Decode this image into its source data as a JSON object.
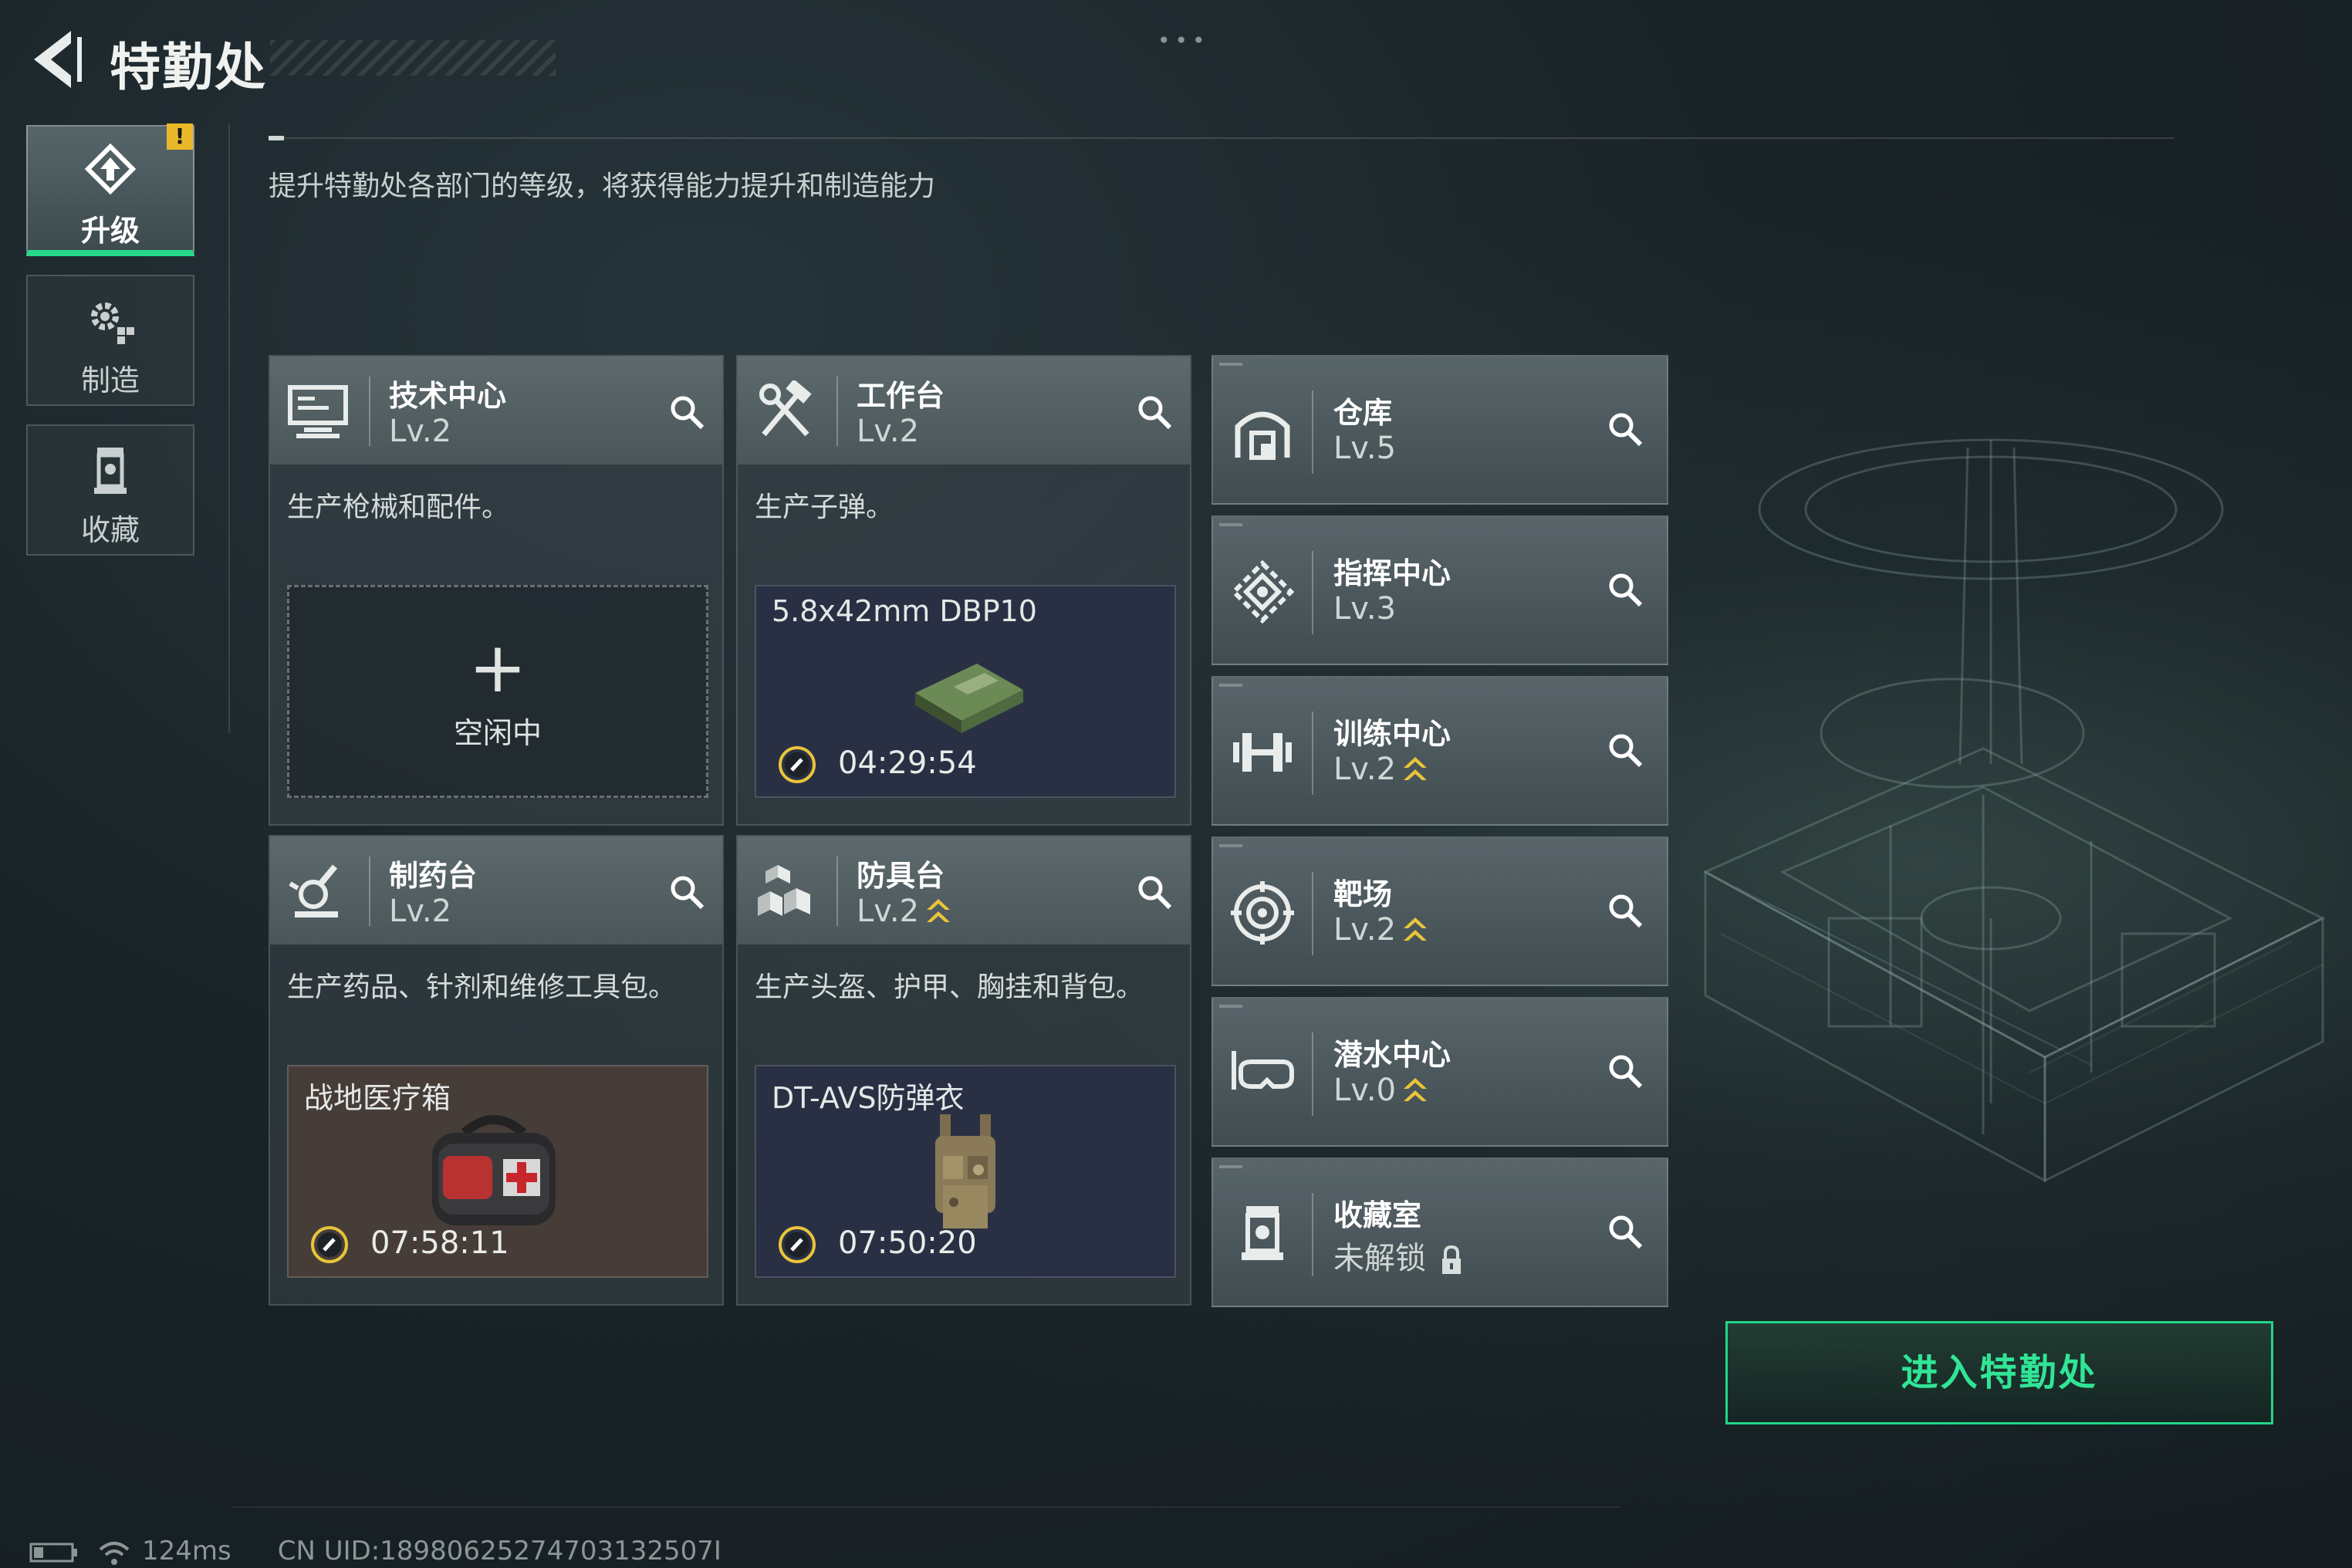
{
  "header": {
    "title": "特勤处"
  },
  "nav": {
    "tabs": [
      {
        "label": "升级",
        "icon": "upgrade-icon",
        "active": true,
        "badge": "!"
      },
      {
        "label": "制造",
        "icon": "gears-icon",
        "active": false
      },
      {
        "label": "收藏",
        "icon": "display-case-icon",
        "active": false
      }
    ]
  },
  "description": "提升特勤处各部门的等级，将获得能力提升和制造能力",
  "production": [
    {
      "name": "技术中心",
      "level": "Lv.2",
      "desc": "生产枪械和配件。",
      "icon": "computer-icon",
      "slot": {
        "state": "idle",
        "plus": "+",
        "status": "空闲中"
      }
    },
    {
      "name": "工作台",
      "level": "Lv.2",
      "desc": "生产子弹。",
      "icon": "hammer-wrench-icon",
      "slot": {
        "state": "busy",
        "item": "5.8x42mm DBP10",
        "time": "04:29:54"
      }
    },
    {
      "name": "制药台",
      "level": "Lv.2",
      "desc": "生产药品、针剂和维修工具包。",
      "icon": "microscope-icon",
      "slot": {
        "state": "busy",
        "item": "战地医疗箱",
        "time": "07:58:11"
      }
    },
    {
      "name": "防具台",
      "level": "Lv.2",
      "desc": "生产头盔、护甲、胸挂和背包。",
      "icon": "armor-blocks-icon",
      "slot": {
        "state": "busy",
        "item": "DT-AVS防弹衣",
        "time": "07:50:20"
      }
    }
  ],
  "facilities": [
    {
      "name": "仓库",
      "level": "Lv.5",
      "icon": "warehouse-icon",
      "upgrade": false
    },
    {
      "name": "指挥中心",
      "level": "Lv.3",
      "icon": "command-center-icon",
      "upgrade": false
    },
    {
      "name": "训练中心",
      "level": "Lv.2",
      "icon": "dumbbell-icon",
      "upgrade": true
    },
    {
      "name": "靶场",
      "level": "Lv.2",
      "icon": "target-icon",
      "upgrade": true
    },
    {
      "name": "潜水中心",
      "level": "Lv.0",
      "icon": "diving-mask-icon",
      "upgrade": true
    },
    {
      "name": "收藏室",
      "level": "未解锁",
      "icon": "display-case-icon",
      "locked": true
    }
  ],
  "enter_button": "进入特勤处",
  "status": {
    "ping": "124ms",
    "uid": "CN UID:18980625274703132507I"
  },
  "colors": {
    "accent": "#27d88c",
    "badge": "#e9b92a",
    "upgrade_arrow": "#e9c53a"
  }
}
